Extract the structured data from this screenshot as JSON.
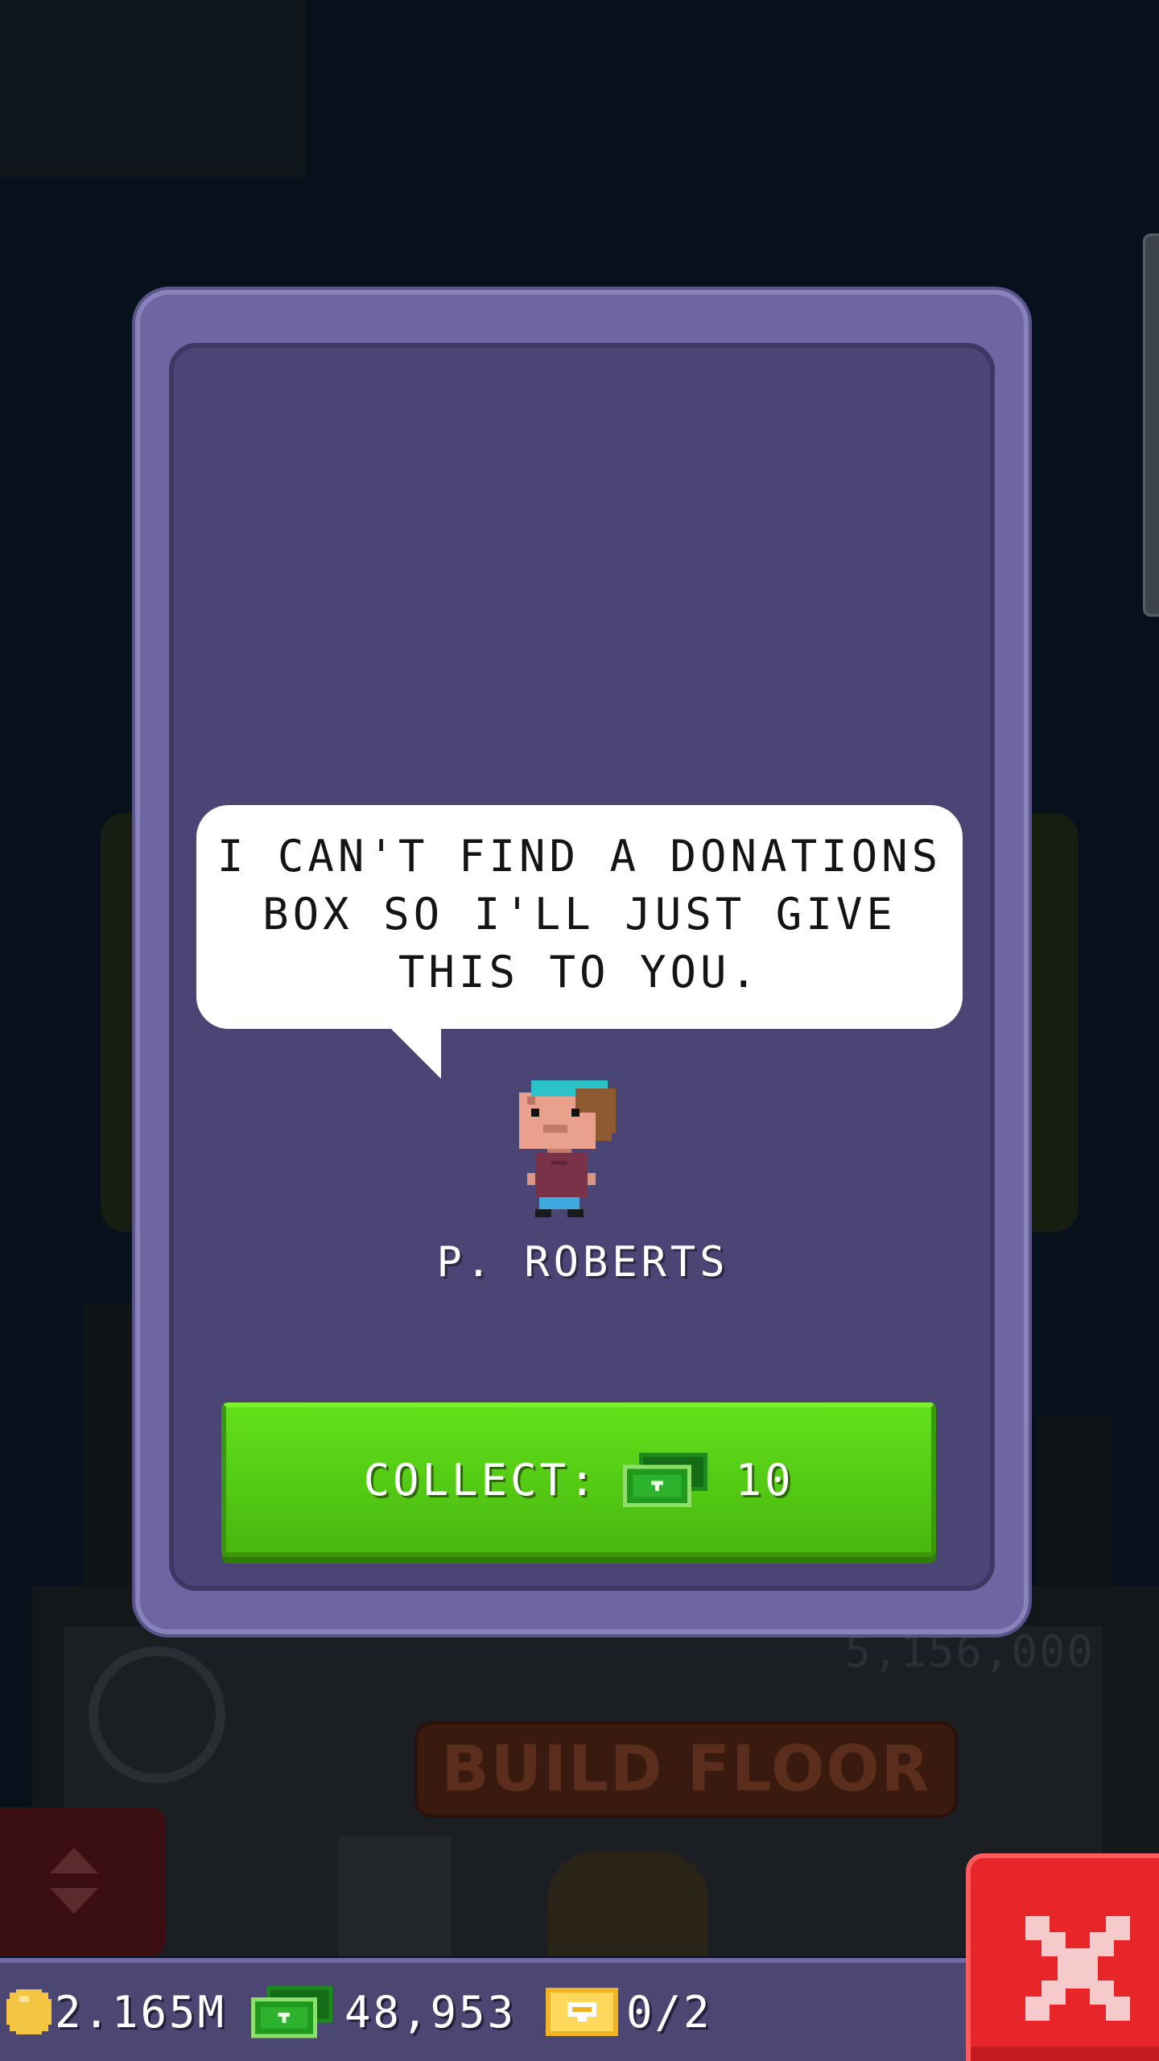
{
  "dialog": {
    "speech": "I CAN'T FIND A DONATIONS BOX SO I'LL JUST GIVE THIS TO YOU.",
    "character_name": "P. ROBERTS",
    "collect_label": "COLLECT:",
    "collect_amount": "10",
    "collect_currency_icon": "tower-bux-icon"
  },
  "background": {
    "cost_text": "5,156,000",
    "build_button_label": "BUILD FLOOR"
  },
  "resources": {
    "coins": "2.165M",
    "bux": "48,953",
    "vip": "0/2"
  },
  "colors": {
    "panel": "#4a4574",
    "panel_border": "#6e66a3",
    "collect_green": "#55cc14",
    "close_red": "#e8262a"
  }
}
